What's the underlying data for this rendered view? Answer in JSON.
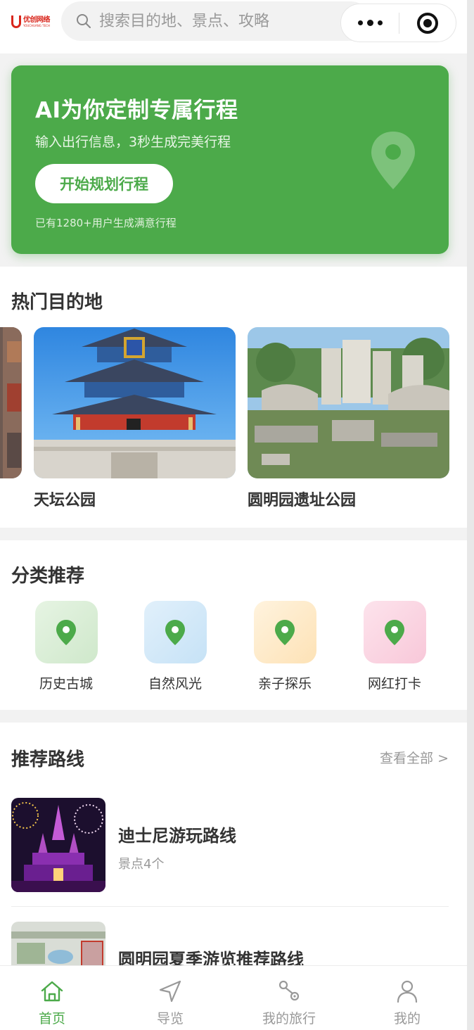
{
  "header": {
    "logo_cn": "优创网络",
    "logo_en": "YOUCHUANG TECH",
    "search_placeholder": "搜索目的地、景点、攻略"
  },
  "banner": {
    "title": "AI为你定制专属行程",
    "subtitle": "输入出行信息，3秒生成完美行程",
    "button": "开始规划行程",
    "note": "已有1280+用户生成满意行程"
  },
  "hot": {
    "title": "热门目的地",
    "items": [
      {
        "name": "天坛公园"
      },
      {
        "name": "圆明园遗址公园"
      }
    ]
  },
  "categories": {
    "title": "分类推荐",
    "items": [
      {
        "label": "历史古城",
        "icon": "location-pin-icon"
      },
      {
        "label": "自然风光",
        "icon": "location-pin-icon"
      },
      {
        "label": "亲子探乐",
        "icon": "location-pin-icon"
      },
      {
        "label": "网红打卡",
        "icon": "location-pin-icon"
      }
    ]
  },
  "routes": {
    "title": "推荐路线",
    "view_all": "查看全部 >",
    "items": [
      {
        "name": "迪士尼游玩路线",
        "count": "景点4个"
      },
      {
        "name": "圆明园夏季游览推荐路线"
      }
    ]
  },
  "tabbar": {
    "items": [
      {
        "label": "首页",
        "icon": "home-icon",
        "active": true
      },
      {
        "label": "导览",
        "icon": "navigation-icon"
      },
      {
        "label": "我的旅行",
        "icon": "route-icon"
      },
      {
        "label": "我的",
        "icon": "user-icon"
      }
    ]
  },
  "colors": {
    "accent": "#4caa4a",
    "brand_red": "#d9261c"
  }
}
